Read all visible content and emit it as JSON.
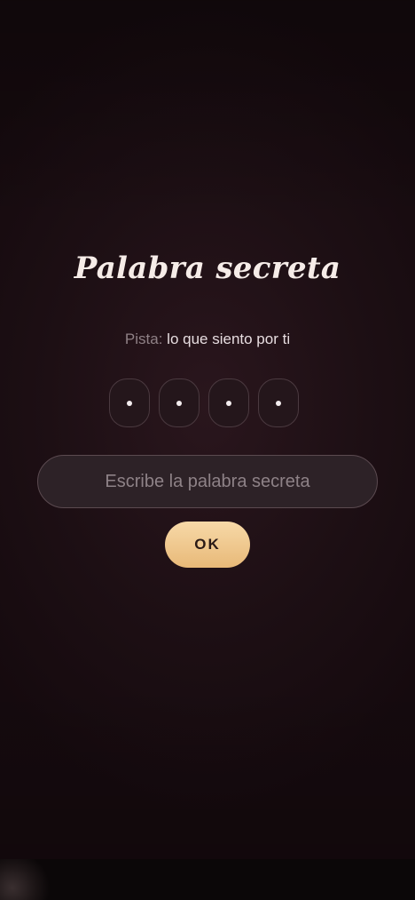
{
  "title": "Palabra secreta",
  "hint": {
    "label": "Pista:",
    "text": "lo que siento por ti"
  },
  "slots": [
    "•",
    "•",
    "•",
    "•"
  ],
  "input": {
    "placeholder": "Escribe la palabra secreta",
    "value": ""
  },
  "button": {
    "label": "OK"
  },
  "colors": {
    "background": "#1d0f14",
    "accent": "#e8b978",
    "title": "#f6ece8"
  }
}
